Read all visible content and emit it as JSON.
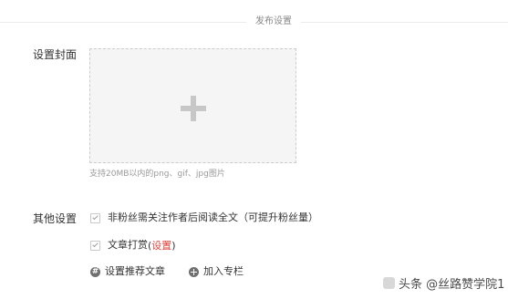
{
  "header": {
    "title": "发布设置"
  },
  "cover": {
    "label": "设置封面",
    "upload_hint": "支持20MB以内的png、gif、jpg图片"
  },
  "other": {
    "label": "其他设置",
    "options": [
      {
        "text": "非粉丝需关注作者后阅读全文（可提升粉丝量）",
        "checked": true
      },
      {
        "text": "文章打赏",
        "paren_open": "(",
        "link": "设置",
        "paren_close": ")",
        "checked": true
      }
    ]
  },
  "actions": {
    "recommend": {
      "label": "设置推荐文章",
      "icon": "hash-circle-icon"
    },
    "column": {
      "label": "加入专栏",
      "icon": "add-circle-icon"
    }
  },
  "watermark": {
    "text": "头条 @丝路赞学院1"
  },
  "colors": {
    "accent_link": "#e0413a",
    "upload_bg": "#f5f5f5",
    "text": "#333333",
    "muted": "#999999"
  }
}
